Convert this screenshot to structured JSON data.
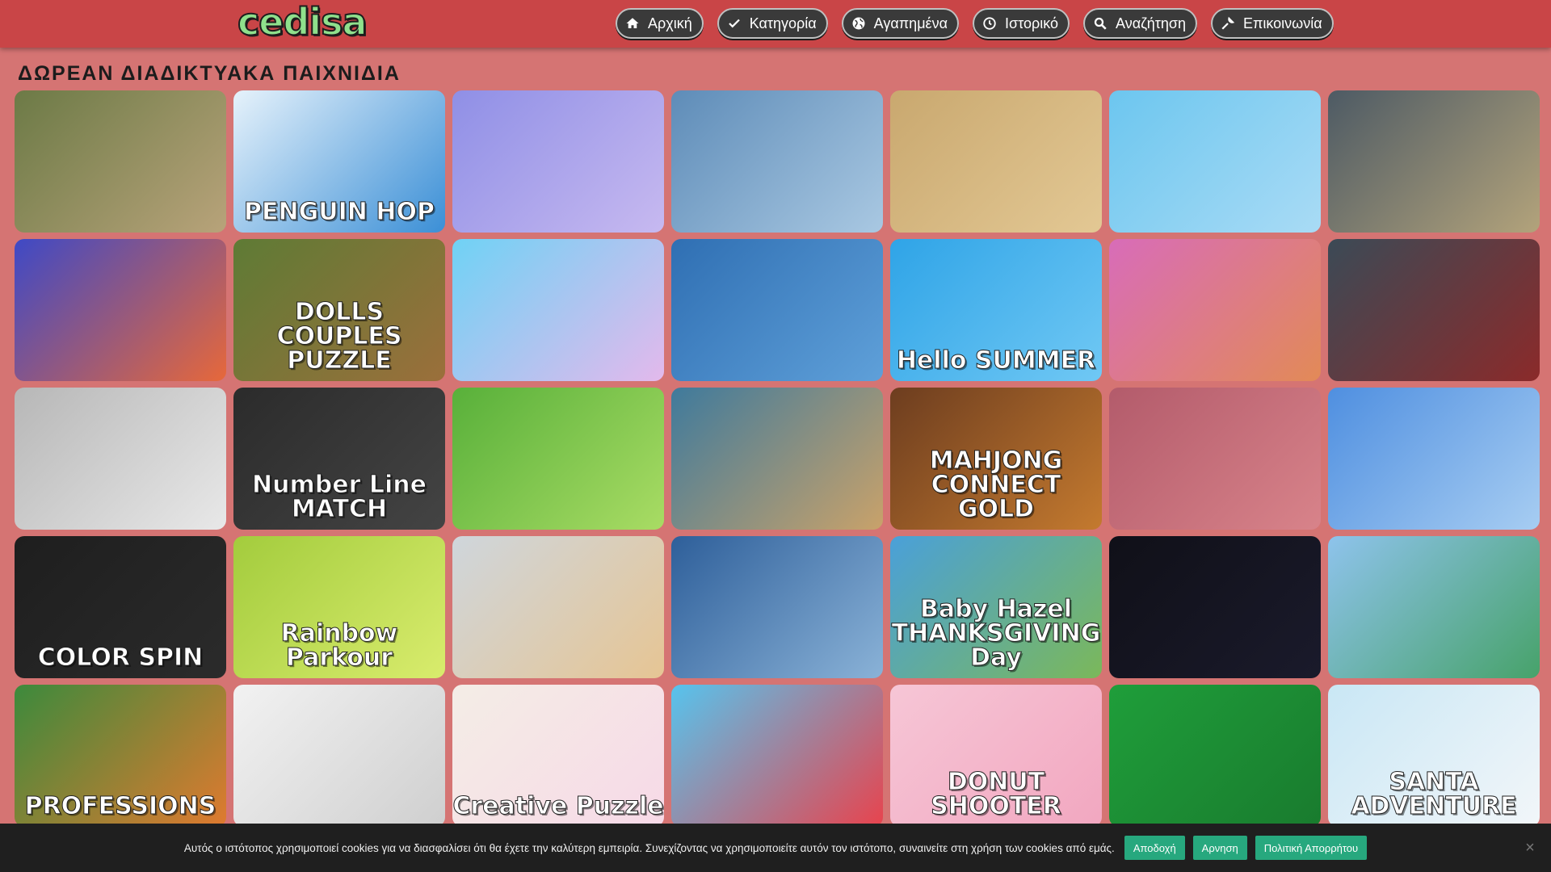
{
  "header": {
    "logo_text": "cedisa",
    "nav": [
      {
        "label": "Αρχική",
        "icon": "home-icon"
      },
      {
        "label": "Κατηγορία",
        "icon": "check-icon"
      },
      {
        "label": "Αγαπημένα",
        "icon": "globe-icon"
      },
      {
        "label": "Ιστορικό",
        "icon": "clock-icon"
      },
      {
        "label": "Αναζήτηση",
        "icon": "search-icon"
      },
      {
        "label": "Επικοινωνία",
        "icon": "wrench-icon"
      }
    ]
  },
  "main": {
    "title": "ΔΩΡΕΑΝ ΔΙΑΔΙΚΤΥΑΚΑ ΠΑΙΧΝΙΔΙΑ",
    "games": [
      {
        "label": "",
        "colors": [
          "#6c7a46",
          "#b8a37a"
        ]
      },
      {
        "label": "PENGUIN HOP",
        "colors": [
          "#e6f2fb",
          "#3b8fd6"
        ]
      },
      {
        "label": "",
        "colors": [
          "#8f8fe6",
          "#c7b9f0"
        ]
      },
      {
        "label": "",
        "colors": [
          "#5e8cb8",
          "#a9c8e2"
        ]
      },
      {
        "label": "",
        "colors": [
          "#c9a86f",
          "#e3c894"
        ]
      },
      {
        "label": "",
        "colors": [
          "#6cc6ef",
          "#a9dbf5"
        ]
      },
      {
        "label": "",
        "colors": [
          "#4d5a64",
          "#b3a37b"
        ]
      },
      {
        "label": "",
        "colors": [
          "#3e49c6",
          "#e7683a"
        ]
      },
      {
        "label": "DOLLS COUPLES PUZZLE",
        "colors": [
          "#5e7b35",
          "#9b6f3b"
        ]
      },
      {
        "label": "",
        "colors": [
          "#6fd2f5",
          "#e3b9ec"
        ]
      },
      {
        "label": "",
        "colors": [
          "#2f6fb3",
          "#5fa0d9"
        ]
      },
      {
        "label": "Hello SUMMER",
        "colors": [
          "#2fa4e7",
          "#70c8f4"
        ]
      },
      {
        "label": "",
        "colors": [
          "#d86cb9",
          "#e28a57"
        ]
      },
      {
        "label": "",
        "colors": [
          "#3b4a56",
          "#8b2a2a"
        ]
      },
      {
        "label": "",
        "colors": [
          "#b7b7b7",
          "#e8e8e8"
        ]
      },
      {
        "label": "Number Line MATCH",
        "colors": [
          "#2b2b2b",
          "#444444"
        ]
      },
      {
        "label": "",
        "colors": [
          "#58b03a",
          "#a9dc64"
        ]
      },
      {
        "label": "",
        "colors": [
          "#3f7a9c",
          "#c9a26a"
        ]
      },
      {
        "label": "MAHJONG CONNECT GOLD",
        "colors": [
          "#6d3d1f",
          "#c47a2f"
        ]
      },
      {
        "label": "",
        "colors": [
          "#b35b6b",
          "#d8838a"
        ]
      },
      {
        "label": "",
        "colors": [
          "#4f8fe0",
          "#a7cdf2"
        ]
      },
      {
        "label": "COLOR SPIN",
        "colors": [
          "#1e1e1e",
          "#2b2b2b"
        ]
      },
      {
        "label": "Rainbow Parkour",
        "colors": [
          "#a3cc3d",
          "#d9ec6d"
        ]
      },
      {
        "label": "",
        "colors": [
          "#cfd6dc",
          "#e6c594"
        ]
      },
      {
        "label": "",
        "colors": [
          "#2e5f9a",
          "#8ab2d7"
        ]
      },
      {
        "label": "Baby Hazel THANKSGIVING Day",
        "colors": [
          "#4aa0d9",
          "#7bb85a"
        ]
      },
      {
        "label": "",
        "colors": [
          "#101018",
          "#1a1a2b"
        ]
      },
      {
        "label": "",
        "colors": [
          "#8ec3ec",
          "#47a26a"
        ]
      },
      {
        "label": "PROFESSIONS",
        "colors": [
          "#3c8a3c",
          "#e07a2f"
        ]
      },
      {
        "label": "",
        "colors": [
          "#f2f2f2",
          "#cfcfcf"
        ]
      },
      {
        "label": "Creative Puzzle",
        "colors": [
          "#f4ede6",
          "#f7d9e7"
        ]
      },
      {
        "label": "",
        "colors": [
          "#56c4ee",
          "#e8434d"
        ]
      },
      {
        "label": "DONUT SHOOTER",
        "colors": [
          "#f6c6d6",
          "#f2a7c0"
        ]
      },
      {
        "label": "",
        "colors": [
          "#1f9e3a",
          "#197b2e"
        ]
      },
      {
        "label": "SANTA ADVENTURE",
        "colors": [
          "#c9e7f5",
          "#f2f6f9"
        ]
      }
    ]
  },
  "cookie": {
    "text": "Αυτός ο ιστότοπος χρησιμοποιεί cookies για να διασφαλίσει ότι θα έχετε την καλύτερη εμπειρία. Συνεχίζοντας να χρησιμοποιείτε αυτόν τον ιστότοπο, συναινείτε στη χρήση των cookies από εμάς.",
    "accept": "Αποδοχή",
    "reject": "Αρνηση",
    "privacy": "Πολιτική Απορρήτου",
    "close": "×"
  }
}
